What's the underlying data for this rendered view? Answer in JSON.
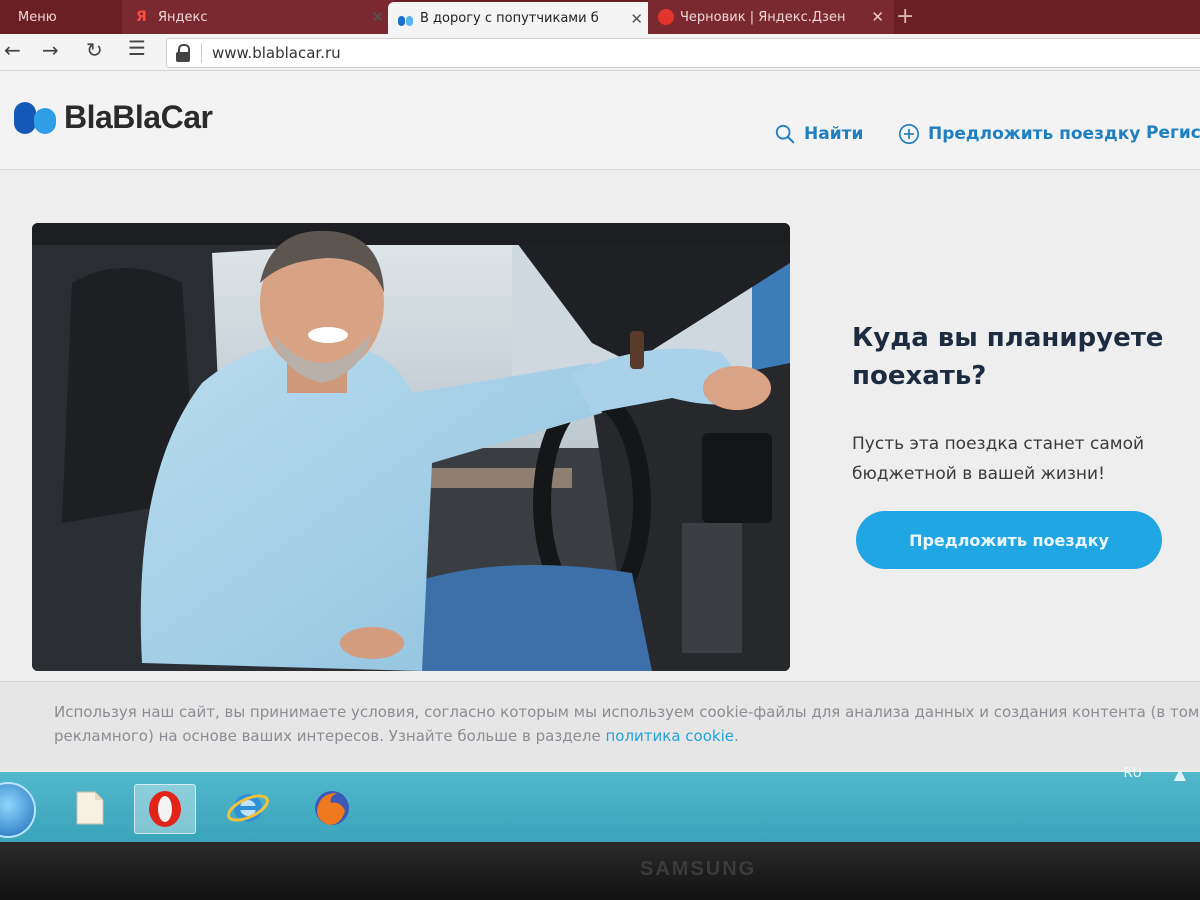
{
  "browser": {
    "tabs": [
      {
        "title": "Меню",
        "active": false
      },
      {
        "title": "Яндекс",
        "active": false
      },
      {
        "title": "В дорогу с попутчиками б",
        "active": true
      },
      {
        "title": "Черновик | Яндекс.Дзен",
        "active": false
      }
    ],
    "new_tab_label": "+",
    "url": "www.blablacar.ru"
  },
  "site": {
    "logo_text": "BlaBlaCar",
    "nav": {
      "find": "Найти",
      "offer": "Предложить поездку",
      "register": "Регист"
    },
    "hero": {
      "title": "Куда вы планируете поехать?",
      "subtitle": "Пусть эта поездка станет самой бюджетной в вашей жизни!",
      "cta": "Предложить поездку"
    },
    "cookie": {
      "text_part1": "Используя наш сайт, вы принимаете условия, согласно которым мы используем cookie-файлы для анализа данных и создания контента (в том ч",
      "text_part2": "рекламного) на основе ваших интересов. Узнайте больше в разделе ",
      "link": "политика cookie",
      "text_end": "."
    }
  },
  "taskbar": {
    "language": "RU",
    "tray_arrow": "▲",
    "apps": [
      "file-explorer",
      "opera",
      "internet-explorer",
      "firefox"
    ]
  },
  "monitor": {
    "brand": "SAMSUNG"
  },
  "colors": {
    "accent": "#20a6e3",
    "link": "#1f7fc0",
    "tabstrip": "#6a1f24",
    "taskbar": "#44aec2"
  }
}
